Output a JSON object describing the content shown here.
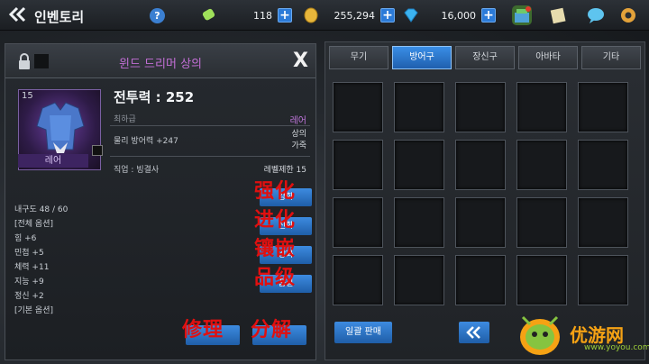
{
  "topbar": {
    "title": "인벤토리",
    "help_label": "?",
    "resources": [
      {
        "name": "energy",
        "value": "118",
        "color": "#9fe05a"
      },
      {
        "name": "gold",
        "value": "255,294",
        "color": "#e7b63b"
      },
      {
        "name": "gem",
        "value": "16,000",
        "color": "#3cb3f0"
      }
    ],
    "plus_label": "+"
  },
  "item": {
    "name": "윈드 드리머 상의",
    "close_label": "X",
    "level": "15",
    "rarity_bar": "레어",
    "power": "전투력 : 252",
    "grade": "최하급",
    "rarity": "레어",
    "stat": "물리 방어력 +247",
    "set_line1": "상의",
    "set_line2": "가죽",
    "job": "직업 : 빙결사",
    "level_req": "레벨제한 15",
    "details": [
      "내구도 48 / 60",
      "[전체 옵션]",
      "힘 +6",
      "민첩 +5",
      "체력 +11",
      "지능 +9",
      "정신 +2",
      "[기본 옵션]"
    ],
    "action_buttons": [
      "강화",
      "진화",
      "강화",
      "품질"
    ],
    "overlay_labels": [
      "强化",
      "进化",
      "镶嵌",
      "品级",
      "修理",
      "分解"
    ]
  },
  "inventory": {
    "tabs": [
      "무기",
      "방어구",
      "장신구",
      "아바타",
      "기타"
    ],
    "active_tab": 1,
    "sell_all_label": "일괄 판매",
    "page_label": "«"
  },
  "watermark": {
    "text": "优游网",
    "sub": "www.yoyou.com"
  }
}
